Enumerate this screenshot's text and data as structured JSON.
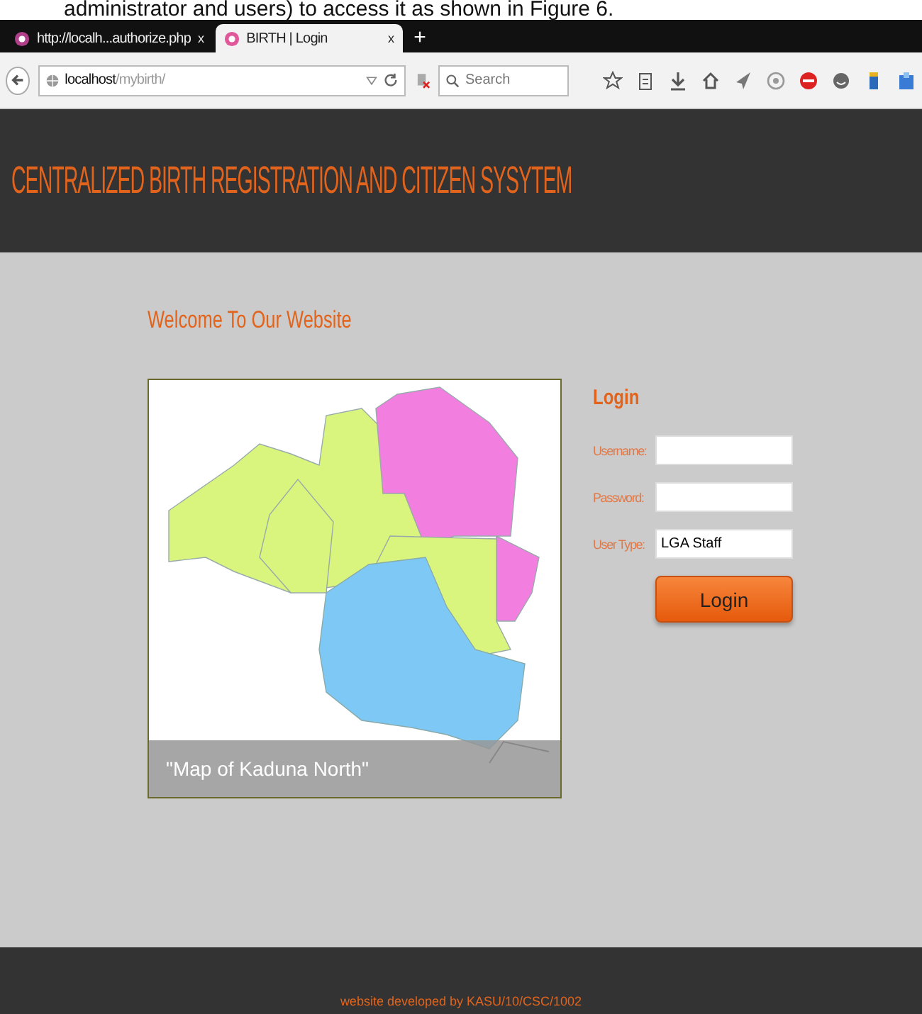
{
  "document_text": "administrator and users) to access it as shown in Figure 6.",
  "browser": {
    "tabs": [
      {
        "title": "http://localh...authorize.php",
        "close": "x",
        "selected": false
      },
      {
        "title": "BIRTH | Login",
        "close": "x",
        "selected": true
      }
    ],
    "new_tab": "+",
    "address": {
      "host": "localhost",
      "path": "/mybirth/"
    },
    "search": {
      "placeholder": "Search"
    }
  },
  "header": {
    "title": "CENTRALIZED BIRTH REGISTRATION AND CITIZEN SYSYTEM"
  },
  "welcome": "Welcome To Our Website",
  "map": {
    "kind": "picture",
    "caption": "\"Map of Kaduna North\""
  },
  "login": {
    "title": "Login",
    "fields": [
      {
        "label": "Username:"
      },
      {
        "label": "Password:"
      },
      {
        "label": "User Type:",
        "value": "LGA Staff"
      }
    ],
    "button": "Login"
  },
  "footer": "website developed by KASU/10/CSC/1002"
}
